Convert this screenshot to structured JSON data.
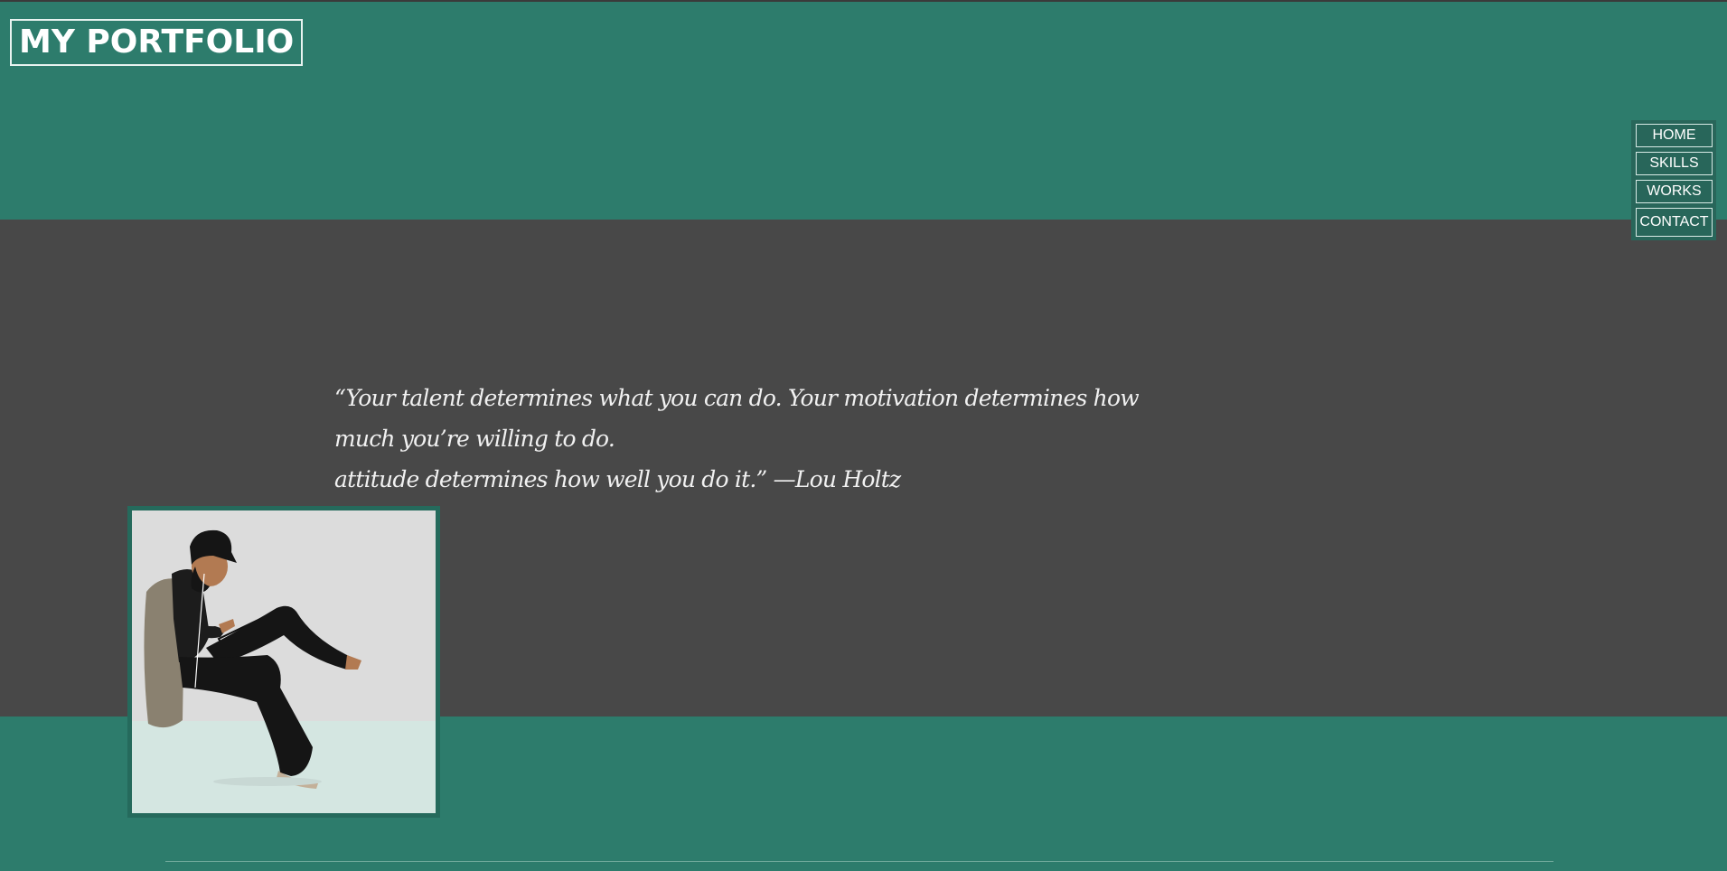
{
  "header": {
    "logo_text": "MY PORTFOLIO"
  },
  "nav": {
    "items": [
      {
        "label": "HOME"
      },
      {
        "label": "SKILLS"
      },
      {
        "label": "WORKS"
      },
      {
        "label": "CONTACT"
      }
    ]
  },
  "hero": {
    "quote_line1": "“Your talent determines what you can do. Your motivation determines how much you’re willing to do.",
    "quote_line2": "attitude determines how well you do it.” —Lou Holtz"
  },
  "colors": {
    "teal": "#2d7c6c",
    "dark_gray": "#484848",
    "nav_bg": "#28665a"
  },
  "portrait": {
    "icon": "man-reading-tablet-illustration"
  }
}
